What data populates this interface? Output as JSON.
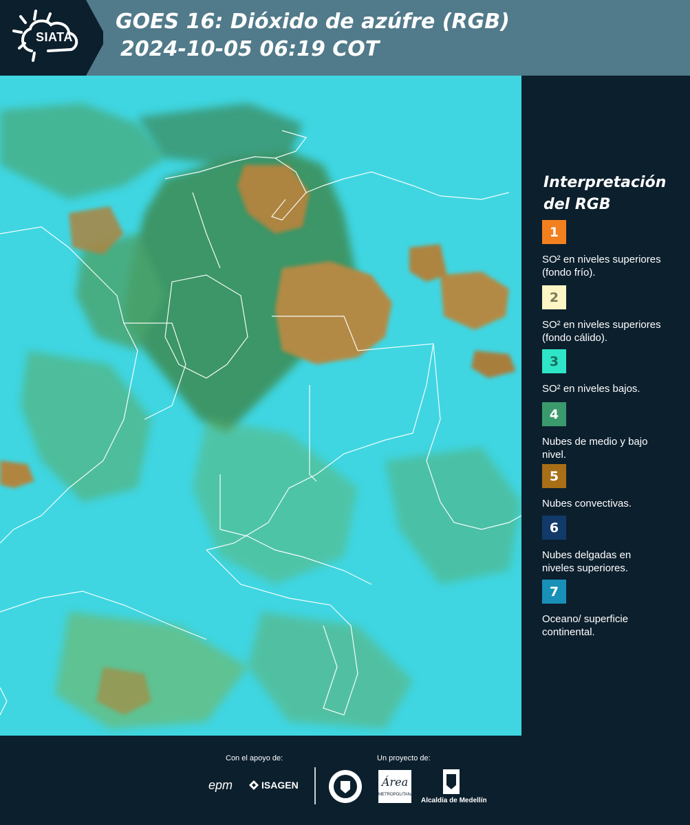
{
  "header": {
    "logo_text": "SIATA",
    "title_line1": "GOES 16: Dióxido de azúfre (RGB)",
    "title_line2": "2024-10-05 06:19 COT"
  },
  "legend": {
    "title_line1": "Interpretación",
    "title_line2": "del RGB",
    "items": [
      {
        "number": "1",
        "label": "SO² en niveles superiores (fondo frío).",
        "color": "#f3801f",
        "text_color": "#ffffff"
      },
      {
        "number": "2",
        "label": "SO² en niveles superiores (fondo cálido).",
        "color": "#fdf6c4",
        "text_color": "#7a7a5a"
      },
      {
        "number": "3",
        "label": "SO² en niveles bajos.",
        "color": "#2ee5c7",
        "text_color": "#1c6b5c"
      },
      {
        "number": "4",
        "label": "Nubes de medio y bajo nivel.",
        "color": "#3a9a6d",
        "text_color": "#ffffff"
      },
      {
        "number": "5",
        "label": "Nubes convectivas.",
        "color": "#a86f17",
        "text_color": "#ffffff"
      },
      {
        "number": "6",
        "label": "Nubes delgadas en niveles superiores.",
        "color": "#113a6a",
        "text_color": "#ffffff"
      },
      {
        "number": "7",
        "label": "Oceano/ superficie continental.",
        "color": "#1890b8",
        "text_color": "#ffffff"
      }
    ]
  },
  "footer": {
    "support_caption": "Con el apoyo de:",
    "project_caption": "Un proyecto de:",
    "epm_text": "epm",
    "isagen_text": "ISAGEN",
    "area_text": "Área",
    "area_subtext": "METROPOLITANA",
    "alcaldia_text": "Alcaldía de Medellín"
  },
  "colors": {
    "background": "#0c1f2d",
    "header_band": "#517a8a",
    "map_cyan": "#3fd6e2",
    "cloud_brown": "#a8823a",
    "veg_green": "#4c9d5c"
  }
}
